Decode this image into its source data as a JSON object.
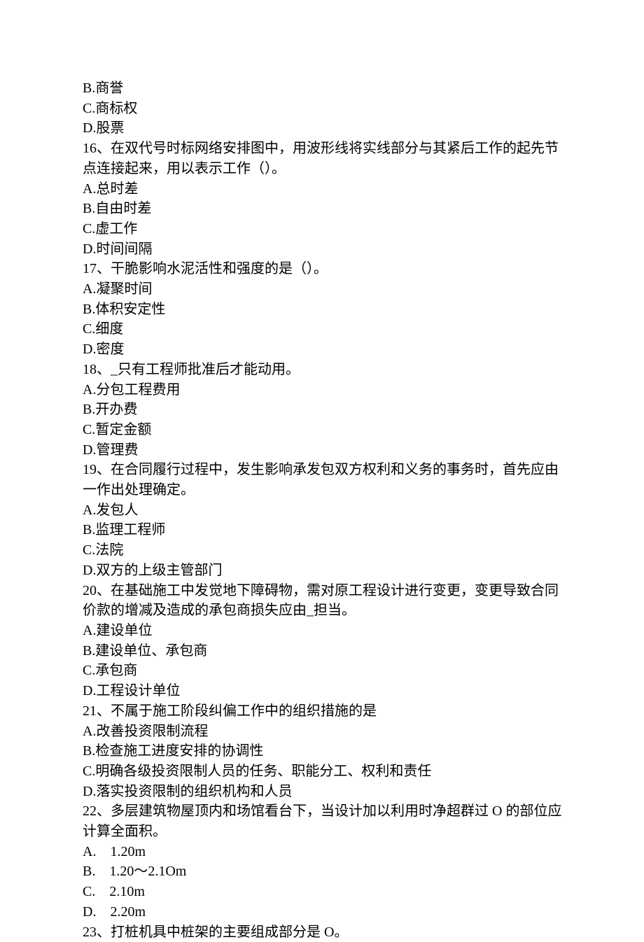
{
  "lines": [
    {
      "t": "B.商誉"
    },
    {
      "t": "C.商标权"
    },
    {
      "t": "D.股票"
    },
    {
      "t": "16、在双代号时标网络安排图中，用波形线将实线部分与其紧后工作的起先节点连接起来，用以表示工作（）。"
    },
    {
      "t": "A.总时差"
    },
    {
      "t": "B.自由时差"
    },
    {
      "t": "C.虚工作"
    },
    {
      "t": "D.时间间隔"
    },
    {
      "t": "17、干脆影响水泥活性和强度的是（）。"
    },
    {
      "t": "A.凝聚时间"
    },
    {
      "t": "B.体积安定性"
    },
    {
      "t": "C.细度"
    },
    {
      "t": "D.密度"
    },
    {
      "t": "18、_只有工程师批准后才能动用。"
    },
    {
      "t": "A.分包工程费用"
    },
    {
      "t": "B.开办费"
    },
    {
      "t": "C.暂定金额"
    },
    {
      "t": "D.管理费"
    },
    {
      "t": "19、在合同履行过程中，发生影响承发包双方权利和义务的事务时，首先应由一作出处理确定。"
    },
    {
      "t": "A.发包人"
    },
    {
      "t": "B.监理工程师"
    },
    {
      "t": "C.法院"
    },
    {
      "t": "D.双方的上级主管部门"
    },
    {
      "t": "20、在基础施工中发觉地下障碍物，需对原工程设计进行变更，变更导致合同价款的增减及造成的承包商损失应由_担当。"
    },
    {
      "t": "A.建设单位"
    },
    {
      "t": "B.建设单位、承包商"
    },
    {
      "t": "C.承包商"
    },
    {
      "t": "D.工程设计单位"
    },
    {
      "t": "21、不属于施工阶段纠偏工作中的组织措施的是"
    },
    {
      "t": "A.改善投资限制流程"
    },
    {
      "t": "B.检查施工进度安排的协调性"
    },
    {
      "t": "C.明确各级投资限制人员的任务、职能分工、权利和责任"
    },
    {
      "t": "D.落实投资限制的组织机构和人员"
    },
    {
      "t": "22、多层建筑物屋顶内和场馆看台下，当设计加以利用时净超群过 O 的部位应计算全面积。"
    },
    {
      "t": "A.    1.20m"
    },
    {
      "t": "B.    1.20～2.1Om"
    },
    {
      "t": "C.    2.10m"
    },
    {
      "t": "D.    2.20m"
    },
    {
      "t": "23、打桩机具中桩架的主要组成部分是 O。"
    }
  ]
}
